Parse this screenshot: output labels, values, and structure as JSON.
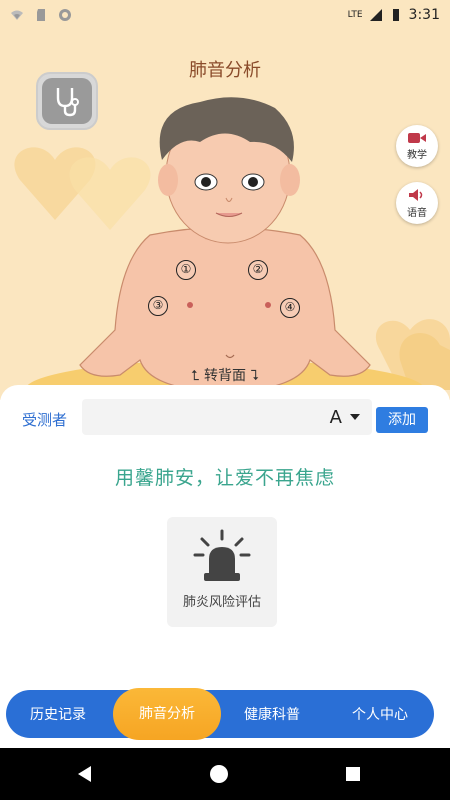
{
  "status_bar": {
    "time": "3:31",
    "network": "LTE",
    "icons": [
      "wifi-icon",
      "sd-card-icon",
      "record-icon",
      "signal-icon",
      "battery-icon"
    ]
  },
  "header": {
    "title": "肺音分析"
  },
  "side_buttons": {
    "teach_label": "教学",
    "voice_label": "语音"
  },
  "points": [
    "①",
    "②",
    "③",
    "④"
  ],
  "flip_label": "转背面",
  "subject": {
    "label": "受测者",
    "value": "A",
    "add_label": "添加"
  },
  "slogan": "用馨肺安，让爱不再焦虑",
  "assessment": {
    "label": "肺炎风险评估",
    "icon": "alarm-icon"
  },
  "tabs": {
    "history": "历史记录",
    "lung_analysis": "肺音分析",
    "health": "健康科普",
    "profile": "个人中心"
  },
  "colors": {
    "hero_bg": "#fbe6c0",
    "accent_blue": "#2a6fd6",
    "active_orange": "#f6a523",
    "slogan_green": "#3aa58e"
  }
}
